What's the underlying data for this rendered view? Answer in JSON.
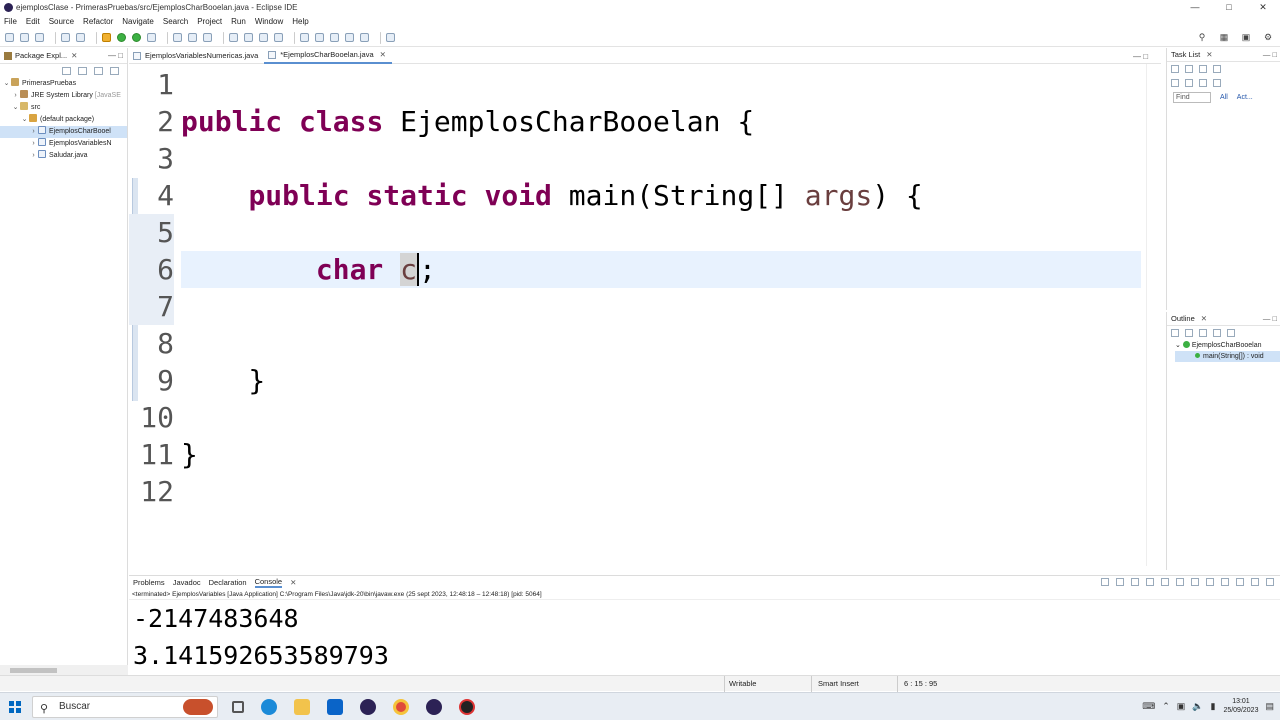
{
  "window": {
    "title": "ejemplosClase - PrimerasPruebas/src/EjemplosCharBooelan.java - Eclipse IDE"
  },
  "menu": [
    "File",
    "Edit",
    "Source",
    "Refactor",
    "Navigate",
    "Search",
    "Project",
    "Run",
    "Window",
    "Help"
  ],
  "package_explorer": {
    "tab_label": "Package Expl...",
    "tree": [
      {
        "label": "PrimerasPruebas",
        "level": 0
      },
      {
        "label": "JRE System Library",
        "suffix": "[JavaSE",
        "level": 1
      },
      {
        "label": "src",
        "level": 1
      },
      {
        "label": "(default package)",
        "level": 2
      },
      {
        "label": "EjemplosCharBooel",
        "level": 3,
        "selected": true
      },
      {
        "label": "EjemplosVariablesN",
        "level": 3
      },
      {
        "label": "Saludar.java",
        "level": 3
      }
    ]
  },
  "editor": {
    "tabs": [
      {
        "label": "EjemplosVariablesNumericas.java",
        "active": false
      },
      {
        "label": "*EjemplosCharBooelan.java",
        "active": true
      }
    ],
    "lines": [
      {
        "n": "1",
        "code": ""
      },
      {
        "n": "2",
        "code": "public class EjemplosCharBooelan {"
      },
      {
        "n": "3",
        "code": ""
      },
      {
        "n": "4",
        "code": "    public static void main(String[] args) {"
      },
      {
        "n": "5",
        "code": ""
      },
      {
        "n": "6",
        "code": "        char c;"
      },
      {
        "n": "7",
        "code": ""
      },
      {
        "n": "8",
        "code": ""
      },
      {
        "n": "9",
        "code": "    }"
      },
      {
        "n": "10",
        "code": ""
      },
      {
        "n": "11",
        "code": "}"
      },
      {
        "n": "12",
        "code": ""
      }
    ]
  },
  "task_list": {
    "tab_label": "Task List",
    "find_placeholder": "Find",
    "all_label": "All",
    "activate_label": "Act..."
  },
  "outline": {
    "tab_label": "Outline",
    "class_name": "EjemplosCharBooelan",
    "method": "main(String[]) : void"
  },
  "console": {
    "tabs": [
      "Problems",
      "Javadoc",
      "Declaration",
      "Console"
    ],
    "active_tab": "Console",
    "description": "<terminated> EjemplosVariables [Java Application] C:\\Program Files\\Java\\jdk-20\\bin\\javaw.exe  (25 sept 2023, 12:48:18 – 12:48:18) [pid: 5064]",
    "output": [
      "-2147483648",
      "3.141592653589793"
    ]
  },
  "status": {
    "writable": "Writable",
    "insert_mode": "Smart Insert",
    "position": "6 : 15 : 95"
  },
  "taskbar": {
    "search_label": "Buscar",
    "time": "13:01",
    "date": "25/09/2023"
  }
}
